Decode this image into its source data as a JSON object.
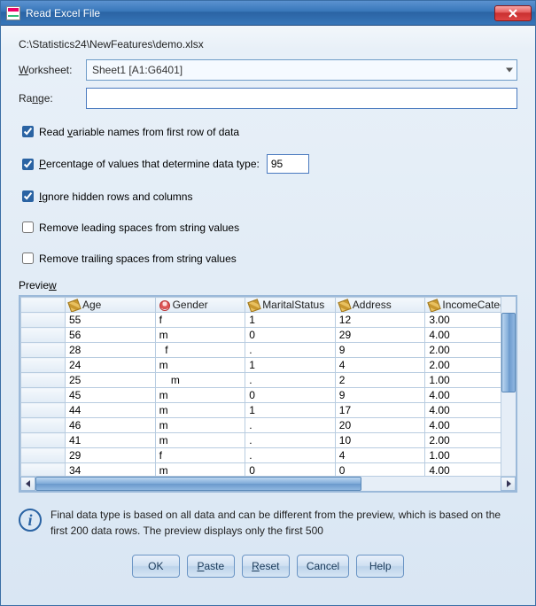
{
  "window": {
    "title": "Read Excel File"
  },
  "filepath": "C:\\Statistics24\\NewFeatures\\demo.xlsx",
  "worksheet_label": "Worksheet:",
  "worksheet_selected": "Sheet1 [A1:G6401]",
  "range_label": "Range:",
  "range_value": "",
  "options": {
    "read_varnames": {
      "checked": true,
      "label_pre": "Read ",
      "label_mn": "v",
      "label_post": "ariable names from first row of data"
    },
    "pct_determine": {
      "checked": true,
      "label_pre": "",
      "label_mn": "P",
      "label_post": "ercentage of values that determine data type:",
      "value": "95"
    },
    "ignore_hidden": {
      "checked": true,
      "label_pre": "",
      "label_mn": "I",
      "label_post": "gnore hidden rows and columns"
    },
    "remove_leading": {
      "checked": false,
      "label_pre": "Remove leading spaces from string values"
    },
    "remove_trailing": {
      "checked": false,
      "label_pre": "Remove trailing spaces from string values"
    }
  },
  "preview_label_pre": "Previe",
  "preview_label_mn": "w",
  "columns": [
    "Age",
    "Gender",
    "MaritalStatus",
    "Address",
    "IncomeCategory"
  ],
  "column_types": [
    "ruler",
    "person",
    "ruler",
    "ruler",
    "ruler"
  ],
  "rows": [
    [
      "55",
      "f",
      "1",
      "12",
      "3.00"
    ],
    [
      "56",
      "m",
      "0",
      "29",
      "4.00"
    ],
    [
      "28",
      "  f",
      ".",
      "9",
      "2.00"
    ],
    [
      "24",
      "m",
      "1",
      "4",
      "2.00"
    ],
    [
      "25",
      "    m",
      ".",
      "2",
      "1.00"
    ],
    [
      "45",
      "m",
      "0",
      "9",
      "4.00"
    ],
    [
      "44",
      "m",
      "1",
      "17",
      "4.00"
    ],
    [
      "46",
      "m",
      ".",
      "20",
      "4.00"
    ],
    [
      "41",
      "m",
      ".",
      "10",
      "2.00"
    ],
    [
      "29",
      "f",
      ".",
      "4",
      "1.00"
    ],
    [
      "34",
      "m",
      "0",
      "0",
      "4.00"
    ]
  ],
  "info_text": "Final data type is based on all data and can be different from the preview, which is based on the first 200 data rows. The preview displays only the first 500",
  "buttons": {
    "ok": "OK",
    "paste": "Paste",
    "reset": "Reset",
    "cancel": "Cancel",
    "help": "Help"
  }
}
